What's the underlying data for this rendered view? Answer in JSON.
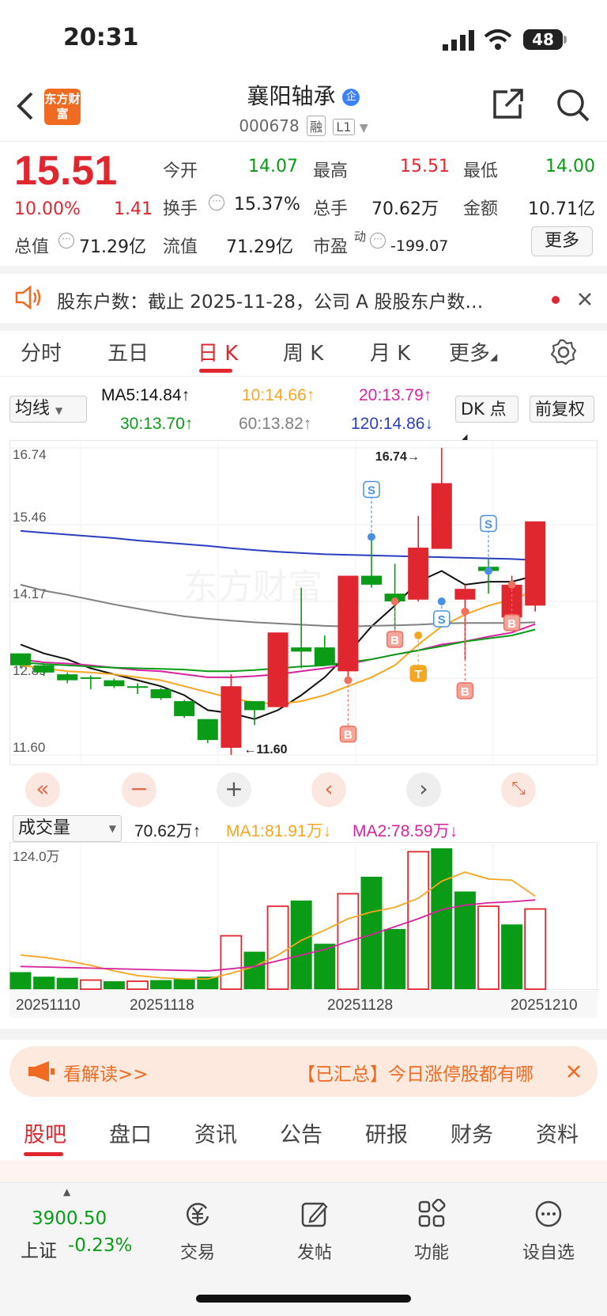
{
  "status_bar": {
    "time": "20:31",
    "battery": "48"
  },
  "header": {
    "logo_text": "东方财富",
    "stock_name": "襄阳轴承",
    "stock_code": "000678",
    "tags": [
      "融",
      "L1"
    ]
  },
  "quote": {
    "price": "15.51",
    "change_pct": "10.00%",
    "change_abs": "1.41",
    "open_label": "今开",
    "open": "14.07",
    "high_label": "最高",
    "high": "15.51",
    "low_label": "最低",
    "low": "14.00",
    "turnover_label": "换手",
    "turnover": "15.37%",
    "volume_label": "总手",
    "volume": "70.62万",
    "amount_label": "金额",
    "amount": "10.71亿",
    "mktcap_label": "总值",
    "mktcap": "71.29亿",
    "float_label": "流值",
    "float": "71.29亿",
    "pe_label": "市盈",
    "pe_sup": "动",
    "pe": "-199.07",
    "more_label": "更多"
  },
  "notice": {
    "text": "股东户数：截止 2025-11-28，公司 A 股股东户数…"
  },
  "period_tabs": [
    {
      "label": "分时",
      "active": false
    },
    {
      "label": "五日",
      "active": false
    },
    {
      "label": "日 K",
      "active": true
    },
    {
      "label": "周 K",
      "active": false
    },
    {
      "label": "月 K",
      "active": false
    },
    {
      "label": "更多",
      "active": false
    }
  ],
  "indicators": {
    "ma_select": "均线",
    "ma5": "MA5:14.84",
    "ma10": "10:14.66",
    "ma20": "20:13.79",
    "ma30": "30:13.70",
    "ma60": "60:13.82",
    "ma120": "120:14.86",
    "dk_label": "DK 点",
    "adjust_label": "前复权",
    "colors": {
      "ma5": "#111111",
      "ma10": "#f5a623",
      "ma20": "#d6249f",
      "ma30": "#0a9b17",
      "ma60": "#808080",
      "ma120": "#2a3fc0"
    }
  },
  "chart_data": [
    {
      "type": "candlestick",
      "y_ticks": [
        "16.74",
        "15.46",
        "14.17",
        "12.89",
        "11.60"
      ],
      "ylim": [
        11.6,
        16.74
      ],
      "high_annotation": "16.74→",
      "low_annotation": "←11.60",
      "candles": [
        {
          "o": 13.3,
          "c": 13.1,
          "h": 13.3,
          "l": 13.05
        },
        {
          "o": 13.1,
          "c": 12.98,
          "h": 13.12,
          "l": 12.92
        },
        {
          "o": 12.95,
          "c": 12.85,
          "h": 12.98,
          "l": 12.8
        },
        {
          "o": 12.9,
          "c": 12.88,
          "h": 12.93,
          "l": 12.7
        },
        {
          "o": 12.85,
          "c": 12.75,
          "h": 12.88,
          "l": 12.72
        },
        {
          "o": 12.75,
          "c": 12.73,
          "h": 12.8,
          "l": 12.62
        },
        {
          "o": 12.7,
          "c": 12.55,
          "h": 12.72,
          "l": 12.52
        },
        {
          "o": 12.5,
          "c": 12.25,
          "h": 12.52,
          "l": 12.22
        },
        {
          "o": 12.2,
          "c": 11.85,
          "h": 12.2,
          "l": 11.8
        },
        {
          "o": 11.72,
          "c": 12.75,
          "h": 12.95,
          "l": 11.6
        },
        {
          "o": 12.5,
          "c": 12.35,
          "h": 12.5,
          "l": 12.1
        },
        {
          "o": 12.4,
          "c": 13.65,
          "h": 13.65,
          "l": 12.4
        },
        {
          "o": 13.4,
          "c": 13.33,
          "h": 14.4,
          "l": 13.05
        },
        {
          "o": 13.4,
          "c": 13.1,
          "h": 13.6,
          "l": 13.1
        },
        {
          "o": 13.0,
          "c": 14.6,
          "h": 14.6,
          "l": 12.88
        },
        {
          "o": 14.6,
          "c": 14.45,
          "h": 15.25,
          "l": 14.4
        },
        {
          "o": 14.3,
          "c": 14.17,
          "h": 14.8,
          "l": 13.7
        },
        {
          "o": 14.2,
          "c": 15.07,
          "h": 15.6,
          "l": 14.17
        },
        {
          "o": 15.05,
          "c": 16.15,
          "h": 16.74,
          "l": 15.05
        },
        {
          "o": 14.2,
          "c": 14.38,
          "h": 14.45,
          "l": 13.2
        },
        {
          "o": 14.75,
          "c": 14.68,
          "h": 14.9,
          "l": 14.3
        },
        {
          "o": 13.9,
          "c": 14.45,
          "h": 14.6,
          "l": 13.85
        },
        {
          "o": 14.1,
          "c": 15.51,
          "h": 15.51,
          "l": 14.0
        }
      ],
      "series": [
        {
          "name": "MA5",
          "values": [
            13.45,
            13.3,
            13.2,
            13.05,
            12.95,
            12.85,
            12.75,
            12.6,
            12.35,
            12.3,
            12.2,
            12.35,
            12.6,
            12.9,
            13.3,
            13.75,
            14.1,
            14.5,
            14.68,
            14.45,
            14.5,
            14.5,
            14.6
          ]
        },
        {
          "name": "MA10",
          "values": [
            13.1,
            13.05,
            13.0,
            12.98,
            12.95,
            12.9,
            12.85,
            12.75,
            12.65,
            12.55,
            12.48,
            12.45,
            12.5,
            12.6,
            12.75,
            12.9,
            13.1,
            13.45,
            13.75,
            13.95,
            14.1,
            14.2,
            14.35
          ]
        },
        {
          "name": "MA20",
          "values": [
            13.2,
            13.15,
            13.13,
            13.1,
            13.06,
            13.02,
            13.0,
            12.95,
            12.9,
            12.9,
            12.92,
            12.95,
            13.0,
            13.05,
            13.12,
            13.2,
            13.28,
            13.35,
            13.45,
            13.5,
            13.58,
            13.65,
            13.79
          ]
        },
        {
          "name": "MA30",
          "values": [
            13.15,
            13.12,
            13.1,
            13.08,
            13.06,
            13.05,
            13.04,
            13.03,
            13.0,
            13.0,
            13.02,
            13.05,
            13.08,
            13.1,
            13.15,
            13.2,
            13.28,
            13.35,
            13.42,
            13.5,
            13.55,
            13.6,
            13.7
          ]
        },
        {
          "name": "MA60",
          "values": [
            14.45,
            14.35,
            14.28,
            14.2,
            14.12,
            14.05,
            13.98,
            13.92,
            13.88,
            13.85,
            13.82,
            13.8,
            13.78,
            13.76,
            13.75,
            13.76,
            13.77,
            13.78,
            13.8,
            13.81,
            13.81,
            13.81,
            13.82
          ]
        },
        {
          "name": "MA120",
          "values": [
            15.35,
            15.32,
            15.29,
            15.26,
            15.23,
            15.19,
            15.16,
            15.13,
            15.1,
            15.06,
            15.03,
            15.0,
            14.98,
            14.96,
            14.95,
            14.94,
            14.93,
            14.92,
            14.91,
            14.9,
            14.89,
            14.88,
            14.86
          ]
        }
      ],
      "markers": [
        {
          "index": 14,
          "label": "B",
          "level": 12.85
        },
        {
          "index": 15,
          "label": "S",
          "level": 15.25
        },
        {
          "index": 16,
          "label": "B",
          "level": 14.17
        },
        {
          "index": 17,
          "label": "T",
          "level": 13.6
        },
        {
          "index": 18,
          "label": "S",
          "level": 14.17
        },
        {
          "index": 19,
          "label": "B",
          "level": 14.0
        },
        {
          "index": 20,
          "label": "S",
          "level": 14.68
        },
        {
          "index": 21,
          "label": "B",
          "level": 14.45
        }
      ]
    },
    {
      "type": "bar",
      "title": "成交量",
      "y_tick": "124.0万",
      "ylim": [
        0,
        124
      ],
      "x_ticks": [
        "20251110",
        "20251118",
        "20251128",
        "20251210"
      ],
      "volumes": [
        15,
        11,
        10,
        8,
        7,
        7,
        8,
        9,
        11,
        47,
        33,
        73,
        78,
        40,
        84,
        99,
        53,
        121,
        124,
        86,
        73,
        57,
        70.62
      ],
      "up": [
        false,
        false,
        false,
        true,
        false,
        true,
        false,
        false,
        false,
        true,
        false,
        true,
        false,
        false,
        true,
        false,
        false,
        true,
        false,
        false,
        true,
        false,
        true
      ],
      "series": [
        {
          "name": "MA1",
          "values": [
            30,
            28,
            25,
            21,
            16,
            12,
            10,
            9,
            9,
            14,
            20,
            30,
            43,
            52,
            62,
            68,
            72,
            80,
            95,
            103,
            97,
            96,
            81.91
          ]
        },
        {
          "name": "MA2",
          "values": [
            20,
            19.5,
            19,
            18.5,
            18,
            17.5,
            17,
            16.5,
            16,
            18,
            20,
            25,
            30,
            35,
            42,
            48,
            55,
            62,
            70,
            74,
            76,
            77,
            78.59
          ]
        }
      ]
    }
  ],
  "volume_info": {
    "select": "成交量",
    "vol": "70.62万",
    "ma1": "MA1:81.91万",
    "ma2": "MA2:78.59万"
  },
  "banner": {
    "left_text": "看解读>>",
    "right_text": "【已汇总】今日涨停股都有哪"
  },
  "bottom_tabs": [
    "股吧",
    "盘口",
    "资讯",
    "公告",
    "研报",
    "财务",
    "资料"
  ],
  "index_info": {
    "value": "3900.50",
    "name": "上证",
    "change": "-0.23%"
  },
  "bottom_nav": [
    "交易",
    "发帖",
    "功能",
    "设自选"
  ]
}
